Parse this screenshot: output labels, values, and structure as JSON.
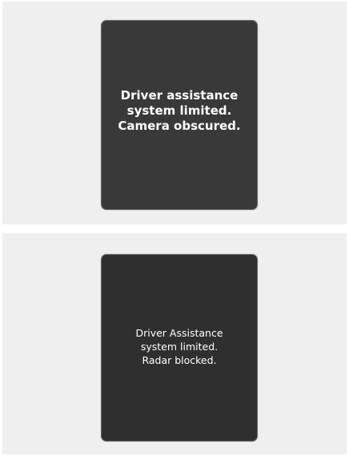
{
  "screens": [
    {
      "message_lines": [
        "Driver assistance",
        "system limited.",
        "Camera obscured."
      ]
    },
    {
      "message_lines": [
        "Driver Assistance",
        "system limited.",
        "Radar blocked."
      ]
    }
  ]
}
